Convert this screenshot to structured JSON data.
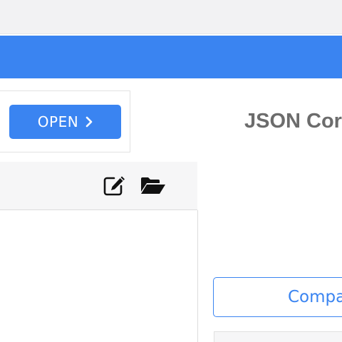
{
  "header": {
    "banner_color": "#3a84f1"
  },
  "open_panel": {
    "button_label": "OPEN",
    "button_icon": "chevron-right-icon"
  },
  "main": {
    "title": "JSON Cor"
  },
  "editor": {
    "toolbar_icons": [
      "edit-icon",
      "folder-open-icon"
    ]
  },
  "actions": {
    "compare_label": "Compa"
  }
}
